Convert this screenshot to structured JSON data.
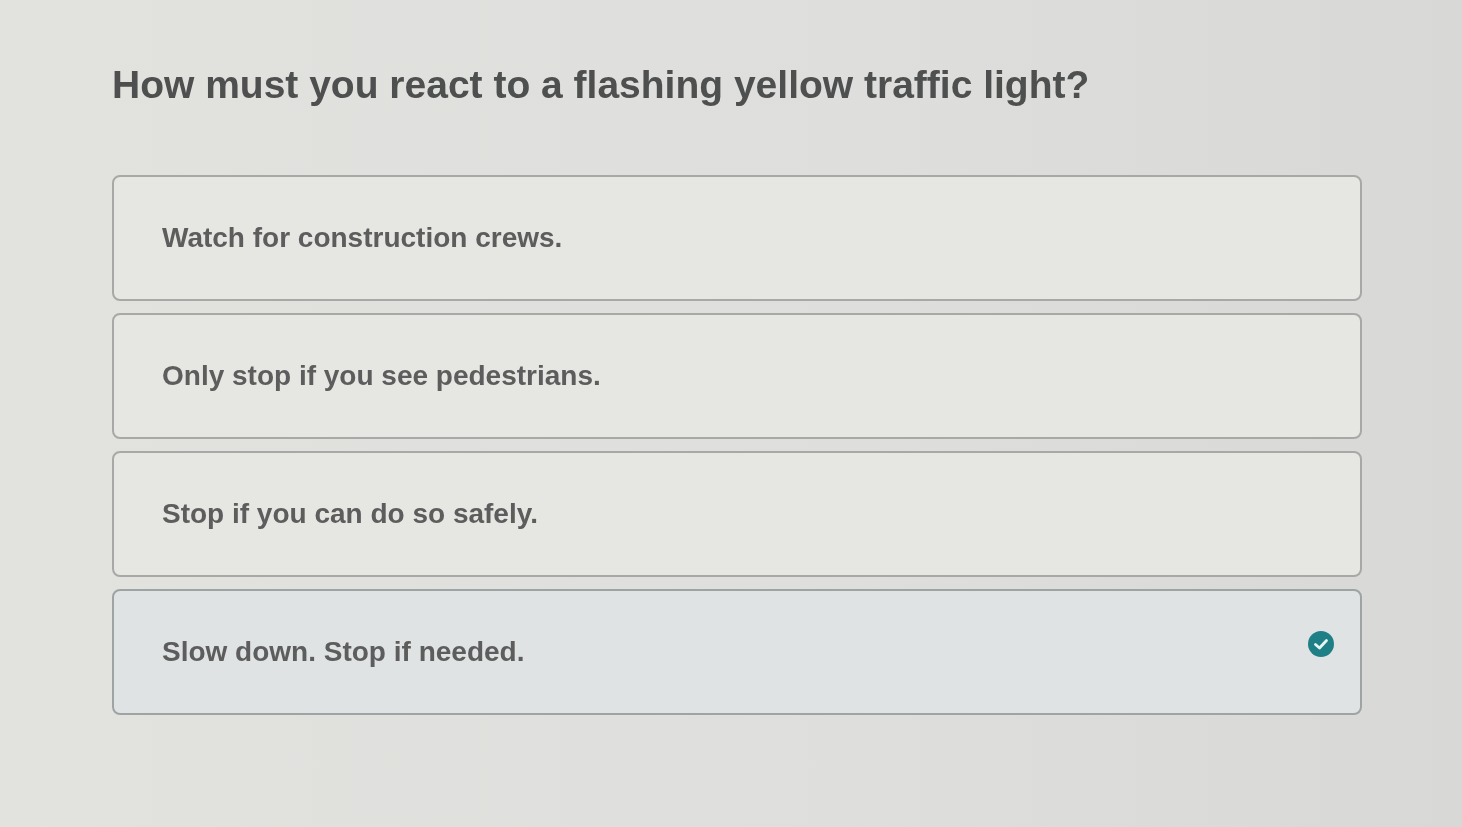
{
  "question": "How must you react to a flashing yellow traffic light?",
  "options": [
    {
      "label": "Watch for construction crews.",
      "selected": false
    },
    {
      "label": "Only stop if you see pedestrians.",
      "selected": false
    },
    {
      "label": "Stop if you can do so safely.",
      "selected": false
    },
    {
      "label": "Slow down. Stop if needed.",
      "selected": true
    }
  ]
}
